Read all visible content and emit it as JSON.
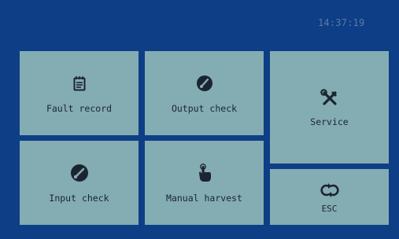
{
  "status_bar": {
    "time": "14:37:19"
  },
  "tiles": {
    "fault_record": {
      "label": "Fault record",
      "icon": "notepad-icon"
    },
    "output_check": {
      "label": "Output check",
      "icon": "gauge-icon"
    },
    "service": {
      "label": "Service",
      "icon": "tools-icon"
    },
    "input_check": {
      "label": "Input check",
      "icon": "gauge-icon"
    },
    "manual_harvest": {
      "label": "Manual harvest",
      "icon": "pointing-hand-icon"
    },
    "esc": {
      "label": "ESC",
      "icon": "refresh-icon"
    }
  },
  "colors": {
    "background": "#0d3e86",
    "tile": "#83adb2",
    "text": "#1b2430",
    "clock": "#5f79a8"
  }
}
